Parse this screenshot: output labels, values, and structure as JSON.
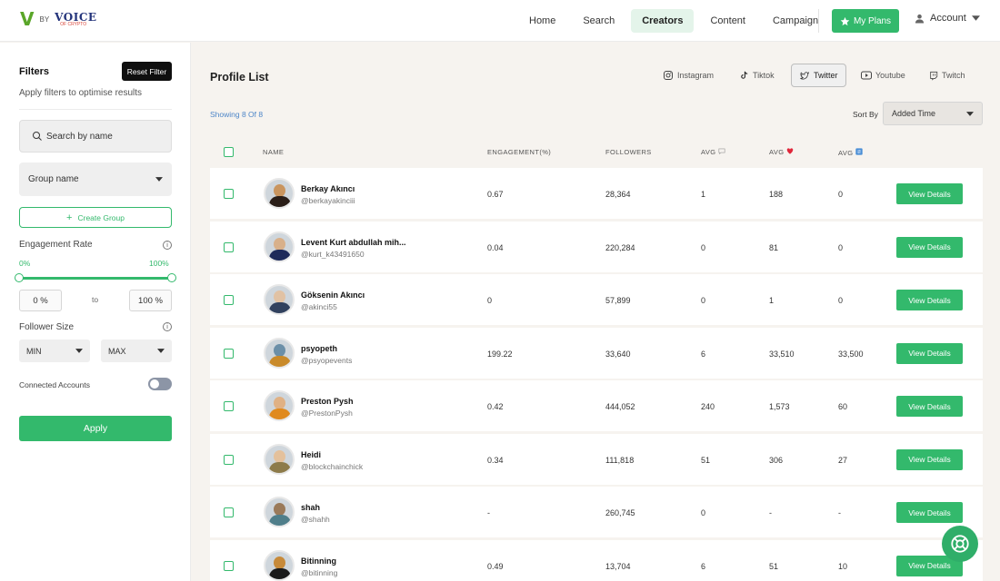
{
  "header": {
    "logo_mark": "V",
    "logo_by": "BY",
    "logo_brand": "VOICE",
    "logo_brand_sub": "OF CRYPTO",
    "nav": [
      {
        "label": "Home",
        "active": false
      },
      {
        "label": "Search",
        "active": false
      },
      {
        "label": "Creators",
        "active": true
      },
      {
        "label": "Content",
        "active": false
      },
      {
        "label": "Campaign",
        "active": false
      }
    ],
    "my_plans_label": "My Plans",
    "account_label": "Account",
    "accent_color": "#33b96c"
  },
  "sidebar": {
    "title": "Filters",
    "reset_label": "Reset Filter",
    "subtitle": "Apply filters to optimise results",
    "search_placeholder": "Search by name",
    "group_select_label": "Group name",
    "create_group_label": "Create Group",
    "engagement_label": "Engagement Rate",
    "engagement_min_label": "0%",
    "engagement_max_label": "100%",
    "engagement_slider_min": 0,
    "engagement_slider_max": 100,
    "engagement_min_value": "0 %",
    "to_label": "to",
    "engagement_max_value": "100 %",
    "follower_label": "Follower Size",
    "follower_min_label": "MIN",
    "follower_max_label": "MAX",
    "connected_label": "Connected Accounts",
    "connected_enabled": false,
    "apply_label": "Apply"
  },
  "main": {
    "title": "Profile List",
    "platforms": [
      {
        "label": "Instagram",
        "icon": "instagram-icon",
        "active": false
      },
      {
        "label": "Tiktok",
        "icon": "tiktok-icon",
        "active": false
      },
      {
        "label": "Twitter",
        "icon": "twitter-icon",
        "active": true
      },
      {
        "label": "Youtube",
        "icon": "youtube-icon",
        "active": false
      },
      {
        "label": "Twitch",
        "icon": "twitch-icon",
        "active": false
      }
    ],
    "showing_text": "Showing 8 Of 8",
    "sort_label": "Sort By",
    "sort_value": "Added Time",
    "columns": {
      "name": "NAME",
      "engagement": "ENGAGEMENT(%)",
      "followers": "FOLLOWERS",
      "avg_comments": "AVG",
      "avg_likes": "AVG",
      "avg_retweets": "AVG"
    },
    "column_icons": [
      "comment-icon",
      "heart-icon",
      "retweet-icon"
    ],
    "details_label": "View Details",
    "rows": [
      {
        "name": "Berkay Akıncı",
        "handle": "@berkayakinciii",
        "engagement": "0.67",
        "followers": "28,364",
        "avg_comments": "1",
        "avg_likes": "188",
        "avg_retweets": "0",
        "avatar_colors": [
          "#c9955f",
          "#2a1e18"
        ]
      },
      {
        "name": "Levent Kurt abdullah mih...",
        "handle": "@kurt_k43491650",
        "engagement": "0.04",
        "followers": "220,284",
        "avg_comments": "0",
        "avg_likes": "81",
        "avg_retweets": "0",
        "avatar_colors": [
          "#d8b08a",
          "#1e2a5a"
        ]
      },
      {
        "name": "Göksenin Akıncı",
        "handle": "@akinci55",
        "engagement": "0",
        "followers": "57,899",
        "avg_comments": "0",
        "avg_likes": "1",
        "avg_retweets": "0",
        "avatar_colors": [
          "#e1c2a4",
          "#31415e"
        ]
      },
      {
        "name": "psyopeth",
        "handle": "@psyopevents",
        "engagement": "199.22",
        "followers": "33,640",
        "avg_comments": "6",
        "avg_likes": "33,510",
        "avg_retweets": "33,500",
        "avatar_colors": [
          "#6b8fa8",
          "#c98a2a"
        ]
      },
      {
        "name": "Preston Pysh",
        "handle": "@PrestonPysh",
        "engagement": "0.42",
        "followers": "444,052",
        "avg_comments": "240",
        "avg_likes": "1,573",
        "avg_retweets": "60",
        "avatar_colors": [
          "#e0b184",
          "#e08a1e"
        ]
      },
      {
        "name": "Heidi",
        "handle": "@blockchainchick",
        "engagement": "0.34",
        "followers": "111,818",
        "avg_comments": "51",
        "avg_likes": "306",
        "avg_retweets": "27",
        "avatar_colors": [
          "#e4c19c",
          "#8d7b4a"
        ]
      },
      {
        "name": "shah",
        "handle": "@shahh",
        "engagement": "-",
        "followers": "260,745",
        "avg_comments": "0",
        "avg_likes": "-",
        "avg_retweets": "-",
        "avatar_colors": [
          "#9a7a5a",
          "#4f7e8a"
        ]
      },
      {
        "name": "Bitinning",
        "handle": "@bitinning",
        "engagement": "0.49",
        "followers": "13,704",
        "avg_comments": "6",
        "avg_likes": "51",
        "avg_retweets": "10",
        "avatar_colors": [
          "#c78a3a",
          "#1a1a1a"
        ]
      }
    ]
  }
}
